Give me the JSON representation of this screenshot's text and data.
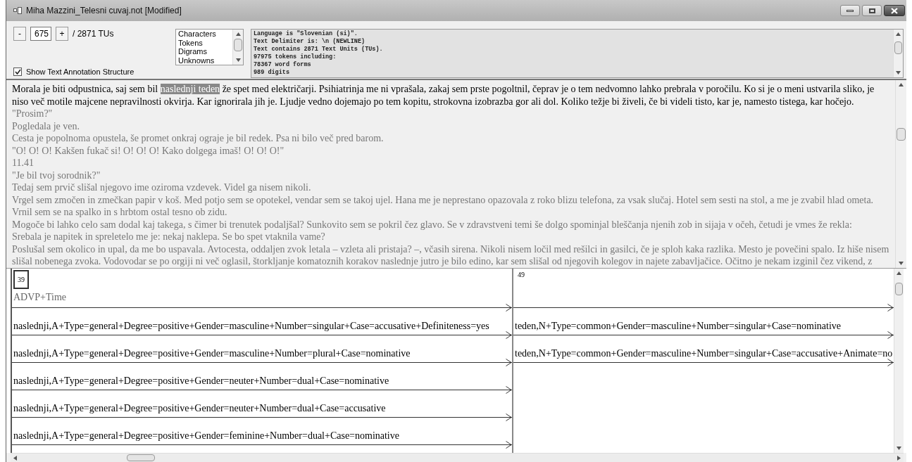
{
  "window": {
    "title": "Miha Mazzini_Telesni cuvaj.not [Modified]"
  },
  "navigator": {
    "decrement": "-",
    "value": "675",
    "increment": "+",
    "total": "/ 2871 TUs"
  },
  "listbox": {
    "items": [
      {
        "label": "Characters",
        "selected": false
      },
      {
        "label": "Tokens",
        "selected": false
      },
      {
        "label": "Digrams",
        "selected": false
      },
      {
        "label": "Unknowns",
        "selected": false
      }
    ]
  },
  "show_structure": {
    "label": "Show Text Annotation Structure",
    "checked": true
  },
  "info_lines": [
    "Language is \"Slovenian (si)\".",
    "Text Delimiter is: \\n (NEWLINE)",
    "Text contains 2871 Text Units (TUs).",
    "97975 tokens including:",
    "78367 word forms",
    "989 digits"
  ],
  "text_units": [
    {
      "current": true,
      "before": "Morala je biti odpustnica, saj sem bil ",
      "highlight": "naslednji teden",
      "after": " že spet med električarji. Psihiatrinja me ni vprašala, zakaj sem prste pogoltnil, čeprav je o tem nedvomno lahko prebrala v poročilu. Ko si je o meni ustvarila sliko, je niso več motile majcene nepravilnosti okvirja. Kar ignorirala jih je. Ljudje vedno dojemajo po tem kopitu, strokovna izobrazba gor ali dol. Koliko težje bi živeli, če bi videli tisto, kar je, namesto tistega, kar hočejo."
    },
    {
      "current": false,
      "before": "\"Prosim?\""
    },
    {
      "current": false,
      "before": "Pogledala je ven."
    },
    {
      "current": false,
      "before": "Cesta je popolnoma opustela, še promet onkraj ograje je bil redek. Psa ni bilo več pred barom."
    },
    {
      "current": false,
      "before": "\"O! O! O! Kakšen fukač si! O! O! O! Kako dolgega imaš! O! O! O!\""
    },
    {
      "current": false,
      "before": "11.41"
    },
    {
      "current": false,
      "before": "\"Je bil tvoj sorodnik?\""
    },
    {
      "current": false,
      "before": "Tedaj sem prvič slišal njegovo ime oziroma vzdevek. Videl ga nisem nikoli."
    },
    {
      "current": false,
      "before": "Vrgel sem zmočen in zmečkan papir v koš. Med potjo sem se opotekel, vendar sem se takoj ujel. Hana me je neprestano opazovala z roko blizu telefona, za vsak slučaj. Hotel sem sesti na stol, a me je zvabil hlad ometa."
    },
    {
      "current": false,
      "before": "Vrnil sem se na spalko in s hrbtom ostal tesno ob zidu."
    },
    {
      "current": false,
      "before": "Mogoče bi lahko celo sam dodal kaj takega, s čimer bi trenutek podaljšal? Sunkovito sem se pokril čez glavo. Se v zdravstveni temi še dolgo spominjal bleščanja njenih zob in sijaja v očeh, četudi je vmes že rekla:"
    },
    {
      "current": false,
      "before": "Srebala je napitek in spreletelo me je: nekaj naklepa. Se bo spet vtaknila vame?"
    },
    {
      "current": false,
      "before": "Poslušal sem okolico in upal, da me bo uspavala. Avtocesta, oddaljen zvok letala – vzleta ali pristaja? –, včasih sirena. Nikoli nisem ločil med rešilci in gasilci, če je sploh kaka razlika. Mesto je povečini spalo. Iz hiše nisem slišal nobenega zvoka. Vodovodar se po orgiji ni več oglasil, štorkljanje komatoznih korakov naslednje jutro je bilo edino, kar sem slišal od njegovih kolegov in najete zabavljačice. Očitno je nekam izginil čez vikend, z"
    }
  ],
  "token_columns": [
    {
      "number": "39",
      "focused": true,
      "label": "ADVP+Time",
      "analyses": [
        "naslednji,A+Type=general+Degree=positive+Gender=masculine+Number=singular+Case=accusative+Definiteness=yes",
        "naslednji,A+Type=general+Degree=positive+Gender=masculine+Number=plural+Case=nominative",
        "naslednji,A+Type=general+Degree=positive+Gender=neuter+Number=dual+Case=nominative",
        "naslednji,A+Type=general+Degree=positive+Gender=neuter+Number=dual+Case=accusative",
        "naslednji,A+Type=general+Degree=positive+Gender=feminine+Number=dual+Case=nominative"
      ]
    },
    {
      "number": "49",
      "focused": false,
      "analyses": [
        "teden,N+Type=common+Gender=masculine+Number=singular+Case=nominative",
        "teden,N+Type=common+Gender=masculine+Number=singular+Case=accusative+Animate=no"
      ]
    }
  ]
}
